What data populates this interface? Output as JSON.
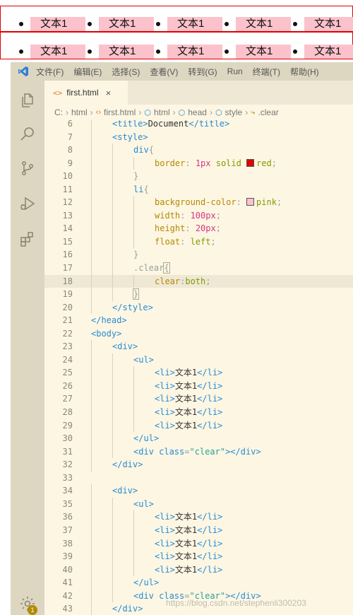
{
  "preview": {
    "row1": [
      "文本1",
      "文本1",
      "文本1",
      "文本1",
      "文本1"
    ],
    "row2": [
      "文本1",
      "文本1",
      "文本1",
      "文本1",
      "文本1"
    ]
  },
  "menu": [
    "文件(F)",
    "编辑(E)",
    "选择(S)",
    "查看(V)",
    "转到(G)",
    "Run",
    "终端(T)",
    "帮助(H)"
  ],
  "tab": {
    "icon": "<>",
    "label": "first.html",
    "close": "×"
  },
  "breadcrumb": {
    "drive": "C:",
    "items": [
      "html",
      "first.html",
      "html",
      "head",
      "style",
      ".clear"
    ]
  },
  "lines": [
    {
      "n": "6",
      "i": 1,
      "t": [
        [
          "tg",
          "<title>"
        ],
        [
          "tx",
          "Document"
        ],
        [
          "tg",
          "</title>"
        ]
      ]
    },
    {
      "n": "7",
      "i": 1,
      "t": [
        [
          "tg",
          "<style>"
        ]
      ]
    },
    {
      "n": "8",
      "i": 2,
      "t": [
        [
          "sel",
          "div"
        ],
        [
          "pn",
          "{"
        ]
      ]
    },
    {
      "n": "9",
      "i": 3,
      "t": [
        [
          "pr",
          "border"
        ],
        [
          "pn",
          ": "
        ],
        [
          "nm",
          "1px"
        ],
        [
          "va",
          " solid "
        ],
        [
          "sw",
          "#e00000"
        ],
        [
          "va",
          "red"
        ],
        [
          "pn",
          ";"
        ]
      ]
    },
    {
      "n": "10",
      "i": 2,
      "t": [
        [
          "pn",
          "}"
        ]
      ]
    },
    {
      "n": "11",
      "i": 2,
      "t": [
        [
          "sel",
          "li"
        ],
        [
          "pn",
          "{"
        ]
      ]
    },
    {
      "n": "12",
      "i": 3,
      "t": [
        [
          "pr",
          "background-color"
        ],
        [
          "pn",
          ": "
        ],
        [
          "sw",
          "#fcc2cc"
        ],
        [
          "va",
          "pink"
        ],
        [
          "pn",
          ";"
        ]
      ]
    },
    {
      "n": "13",
      "i": 3,
      "t": [
        [
          "pr",
          "width"
        ],
        [
          "pn",
          ": "
        ],
        [
          "nm",
          "100px"
        ],
        [
          "pn",
          ";"
        ]
      ]
    },
    {
      "n": "14",
      "i": 3,
      "t": [
        [
          "pr",
          "height"
        ],
        [
          "pn",
          ": "
        ],
        [
          "nm",
          "20px"
        ],
        [
          "pn",
          ";"
        ]
      ]
    },
    {
      "n": "15",
      "i": 3,
      "t": [
        [
          "pr",
          "float"
        ],
        [
          "pn",
          ": "
        ],
        [
          "va",
          "left"
        ],
        [
          "pn",
          ";"
        ]
      ]
    },
    {
      "n": "16",
      "i": 2,
      "t": [
        [
          "pn",
          "}"
        ]
      ]
    },
    {
      "n": "17",
      "i": 2,
      "t": [
        [
          "pn",
          ".clear"
        ],
        [
          "bx",
          "{"
        ]
      ]
    },
    {
      "n": "18",
      "i": 3,
      "hl": true,
      "t": [
        [
          "pr",
          "clear"
        ],
        [
          "pn",
          ":"
        ],
        [
          "va",
          "both"
        ],
        [
          "pn",
          ";"
        ]
      ]
    },
    {
      "n": "19",
      "i": 2,
      "t": [
        [
          "bx",
          "}"
        ]
      ]
    },
    {
      "n": "20",
      "i": 1,
      "t": [
        [
          "tg",
          "</style>"
        ]
      ]
    },
    {
      "n": "21",
      "i": 0,
      "t": [
        [
          "tg",
          "</head>"
        ]
      ]
    },
    {
      "n": "22",
      "i": 0,
      "t": [
        [
          "tg",
          "<body>"
        ]
      ]
    },
    {
      "n": "23",
      "i": 1,
      "t": [
        [
          "tg",
          "<div>"
        ]
      ]
    },
    {
      "n": "24",
      "i": 2,
      "t": [
        [
          "tg",
          "<ul>"
        ]
      ]
    },
    {
      "n": "25",
      "i": 3,
      "t": [
        [
          "tg",
          "<li>"
        ],
        [
          "tx",
          "文本1"
        ],
        [
          "tg",
          "</li>"
        ]
      ]
    },
    {
      "n": "26",
      "i": 3,
      "t": [
        [
          "tg",
          "<li>"
        ],
        [
          "tx",
          "文本1"
        ],
        [
          "tg",
          "</li>"
        ]
      ]
    },
    {
      "n": "27",
      "i": 3,
      "t": [
        [
          "tg",
          "<li>"
        ],
        [
          "tx",
          "文本1"
        ],
        [
          "tg",
          "</li>"
        ]
      ]
    },
    {
      "n": "28",
      "i": 3,
      "t": [
        [
          "tg",
          "<li>"
        ],
        [
          "tx",
          "文本1"
        ],
        [
          "tg",
          "</li>"
        ]
      ]
    },
    {
      "n": "29",
      "i": 3,
      "t": [
        [
          "tg",
          "<li>"
        ],
        [
          "tx",
          "文本1"
        ],
        [
          "tg",
          "</li>"
        ]
      ]
    },
    {
      "n": "30",
      "i": 2,
      "t": [
        [
          "tg",
          "</ul>"
        ]
      ]
    },
    {
      "n": "31",
      "i": 2,
      "t": [
        [
          "tg",
          "<div "
        ],
        [
          "at",
          "class"
        ],
        [
          "pn",
          "="
        ],
        [
          "st",
          "\"clear\""
        ],
        [
          "tg",
          "></div>"
        ]
      ]
    },
    {
      "n": "32",
      "i": 1,
      "t": [
        [
          "tg",
          "</div>"
        ]
      ]
    },
    {
      "n": "33",
      "i": 0,
      "t": []
    },
    {
      "n": "34",
      "i": 1,
      "t": [
        [
          "tg",
          "<div>"
        ]
      ]
    },
    {
      "n": "35",
      "i": 2,
      "t": [
        [
          "tg",
          "<ul>"
        ]
      ]
    },
    {
      "n": "36",
      "i": 3,
      "t": [
        [
          "tg",
          "<li>"
        ],
        [
          "tx",
          "文本1"
        ],
        [
          "tg",
          "</li>"
        ]
      ]
    },
    {
      "n": "37",
      "i": 3,
      "t": [
        [
          "tg",
          "<li>"
        ],
        [
          "tx",
          "文本1"
        ],
        [
          "tg",
          "</li>"
        ]
      ]
    },
    {
      "n": "38",
      "i": 3,
      "t": [
        [
          "tg",
          "<li>"
        ],
        [
          "tx",
          "文本1"
        ],
        [
          "tg",
          "</li>"
        ]
      ]
    },
    {
      "n": "39",
      "i": 3,
      "t": [
        [
          "tg",
          "<li>"
        ],
        [
          "tx",
          "文本1"
        ],
        [
          "tg",
          "</li>"
        ]
      ]
    },
    {
      "n": "40",
      "i": 3,
      "t": [
        [
          "tg",
          "<li>"
        ],
        [
          "tx",
          "文本1"
        ],
        [
          "tg",
          "</li>"
        ]
      ]
    },
    {
      "n": "41",
      "i": 2,
      "t": [
        [
          "tg",
          "</ul>"
        ]
      ]
    },
    {
      "n": "42",
      "i": 2,
      "t": [
        [
          "tg",
          "<div "
        ],
        [
          "at",
          "class"
        ],
        [
          "pn",
          "="
        ],
        [
          "st",
          "\"clear\""
        ],
        [
          "tg",
          "></div>"
        ]
      ]
    },
    {
      "n": "43",
      "i": 1,
      "t": [
        [
          "tg",
          "</div>"
        ]
      ]
    }
  ],
  "badge": "1",
  "watermark": "https://blog.csdn.net/stephenli300203",
  "colors": {
    "accent": "#268bd2",
    "border_red": "#e00000",
    "pink": "#fcc2cc"
  }
}
